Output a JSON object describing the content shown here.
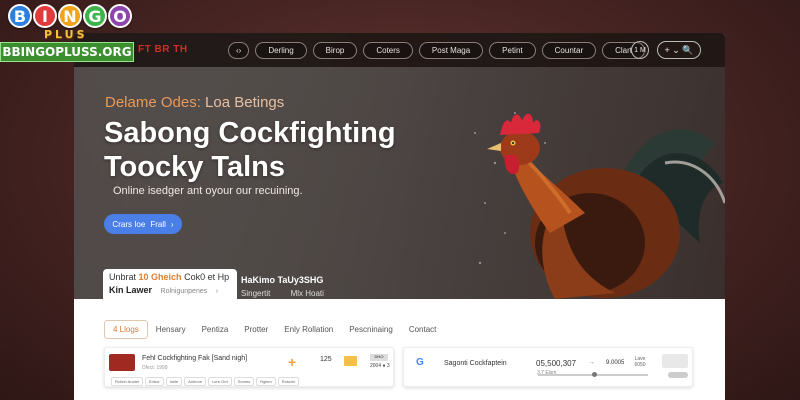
{
  "logo": {
    "letters": [
      "B",
      "I",
      "N",
      "G",
      "O"
    ],
    "plus": "PLUS",
    "site": "BBINGOPLUSS.ORG"
  },
  "nav": {
    "brand": "FT BR TH",
    "items": [
      "Derling",
      "Birop",
      "Coters",
      "Post Maga",
      "Petint",
      "Countar",
      "Clart"
    ],
    "badge": "1 M",
    "search_label": "+ ⌄ 🔍"
  },
  "hero": {
    "kicker_main": "Delame Odes:",
    "kicker_rest": "Loa Betings",
    "title": "Sabong Cockfighting Toocky Talns",
    "subtitle": "Online isedger ant oyour our recuining.",
    "cta_label": "Crars Ioe",
    "cta_suffix": "Frall",
    "card_a_line1_pre": "Unbrat",
    "card_a_line1_hi": "10 Gheich",
    "card_a_line1_post": "Cok0 et Hp",
    "card_a_line2": "Kin Lawer",
    "card_a_line2_small": "Rolnigunpenes",
    "card_b_line1": "HaKimo TaUy3SHG",
    "card_b_line2a": "Singertit",
    "card_b_line2b": "Mlx Hoati"
  },
  "tabs": [
    "4 Llogs",
    "Hensary",
    "Pentiza",
    "Protter",
    "Enly Rollation",
    "Pescninaing",
    "Contact"
  ],
  "card1": {
    "name": "Fehl Cockfighting Fak [Sand nigh]",
    "sub": "Dfect: 1999",
    "number": "125",
    "tag": "DHO",
    "meta": "2004 ● 3",
    "chips": [
      "Rchrtn Anotel",
      "Enbor",
      "Imile",
      "Anlrnoe",
      "Lore Ord",
      "Somes",
      "Rglem",
      "Rotoxin"
    ]
  },
  "card2": {
    "g": "G",
    "name": "Sagonti Cockfaptein",
    "amount": "05,500,307",
    "arrow": "→",
    "value": "9.0005",
    "level_top": "Lave",
    "level_bottom": "6050",
    "slider_label": "3.7 Elsm"
  }
}
